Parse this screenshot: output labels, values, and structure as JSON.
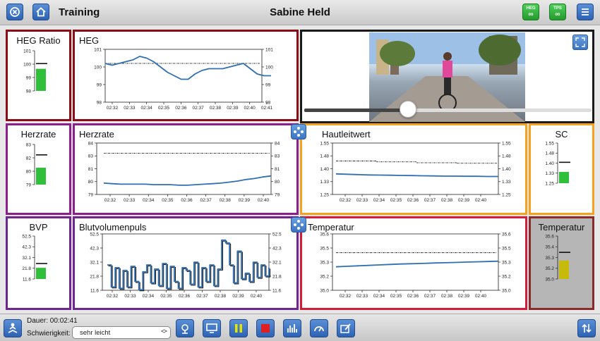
{
  "header": {
    "title": "Training",
    "user": "Sabine Held",
    "heg_btn": "HEG",
    "tps_btn": "TPS"
  },
  "colors": {
    "heg": "#8b0d17",
    "herzrate": "#8b1f8c",
    "hautleitwert": "#f5a21e",
    "bvp": "#6e2690",
    "temperatur": "#d21e3c",
    "video": "#1a1a1a",
    "line": "#2f6fb2",
    "bar_green": "#2fbf3a",
    "bar_yellow": "#c6bb0a"
  },
  "panels": {
    "heg_ratio": {
      "title": "HEG Ratio",
      "ticks": [
        "101",
        "100",
        "99",
        "98"
      ],
      "fill": 0.55,
      "target": 0.68
    },
    "heg": {
      "title": "HEG"
    },
    "herzrate_small": {
      "title": "Herzrate",
      "ticks": [
        "83",
        "82",
        "80",
        "79"
      ],
      "fill": 0.42,
      "target": 0.74
    },
    "herzrate": {
      "title": "Herzrate"
    },
    "haut": {
      "title": "Hautleitwert"
    },
    "sc": {
      "title": "SC",
      "ticks": [
        "1.55",
        "1.48",
        "1.40",
        "1.33",
        "1.25"
      ],
      "fill": 0.28,
      "target": 0.52
    },
    "bvp_small": {
      "title": "BVP",
      "ticks": [
        "52.5",
        "42.3",
        "32.1",
        "21.8",
        "11.6"
      ],
      "fill": 0.26,
      "target": 0.36
    },
    "bvp": {
      "title": "Blutvolumenpuls"
    },
    "temp": {
      "title": "Temperatur"
    },
    "temp_small": {
      "title": "Temperatur",
      "ticks": [
        "35.6",
        "35.4",
        "35.3",
        "35.2",
        "35.0"
      ],
      "fill": 0.43,
      "target": 0.62
    }
  },
  "video": {
    "progress": 0.36
  },
  "footer": {
    "dauer_label": "Dauer: 00:02:41",
    "schwierigkeit_label": "Schwierigkeit:",
    "difficulty": "sehr leicht"
  },
  "chart_data": [
    {
      "type": "line",
      "name": "HEG",
      "x_ticks": [
        "02:32",
        "02:33",
        "02:34",
        "02:35",
        "02:36",
        "02:37",
        "02:38",
        "02:39",
        "02:40",
        "02:41"
      ],
      "y_ticks": [
        "101",
        "100",
        "99",
        "98"
      ],
      "ylim": [
        98,
        101
      ],
      "threshold": 100.2,
      "values": [
        100.2,
        100.1,
        100.2,
        100.3,
        100.4,
        100.6,
        100.5,
        100.3,
        100.0,
        99.7,
        99.5,
        99.3,
        99.3,
        99.6,
        99.8,
        99.9,
        99.9,
        99.9,
        100.0,
        100.1,
        100.2,
        99.9,
        99.6,
        99.5,
        99.5
      ]
    },
    {
      "type": "line",
      "name": "Herzrate",
      "x_ticks": [
        "02:32",
        "02:33",
        "02:34",
        "02:35",
        "02:36",
        "02:37",
        "02:38",
        "02:39",
        "02:40"
      ],
      "y_ticks": [
        "84",
        "83",
        "81",
        "80",
        "79"
      ],
      "ylim": [
        79,
        84
      ],
      "threshold": 83.0,
      "values": [
        80.1,
        80.05,
        80.0,
        80.0,
        80.0,
        80.0,
        79.95,
        79.95,
        79.95,
        79.9,
        79.9,
        79.95,
        80.0,
        80.05,
        80.1,
        80.2,
        80.3,
        80.45,
        80.55,
        80.7,
        80.8
      ]
    },
    {
      "type": "line",
      "name": "Hautleitwert",
      "x_ticks": [
        "02:32",
        "02:33",
        "02:34",
        "02:35",
        "02:36",
        "02:37",
        "02:38",
        "02:39",
        "02:40"
      ],
      "y_ticks": [
        "1.55",
        "1.48",
        "1.40",
        "1.33",
        "1.25"
      ],
      "ylim": [
        1.25,
        1.55
      ],
      "threshold_steps": [
        1.445,
        1.44,
        1.435,
        1.432
      ],
      "values": [
        1.37,
        1.368,
        1.366,
        1.364,
        1.363,
        1.362,
        1.361,
        1.36,
        1.359,
        1.358,
        1.357,
        1.357,
        1.356,
        1.356,
        1.355,
        1.355
      ]
    },
    {
      "type": "line",
      "name": "Blutvolumenpuls",
      "x_ticks": [
        "02:32",
        "02:33",
        "02:34",
        "02:35",
        "02:36",
        "02:37",
        "02:38",
        "02:39",
        "02:40"
      ],
      "y_ticks": [
        "52.5",
        "42.3",
        "32.1",
        "21.8",
        "11.6"
      ],
      "ylim": [
        11.6,
        52.5
      ],
      "values": [
        30,
        14,
        28,
        13,
        26,
        14,
        29,
        18,
        12,
        25,
        30,
        17,
        27,
        15,
        31,
        13,
        29,
        18,
        13,
        28,
        26,
        16,
        32,
        14,
        28,
        18,
        30,
        15,
        27,
        48,
        46,
        30,
        17,
        40,
        20,
        24,
        18,
        32,
        21,
        30,
        22,
        28
      ]
    },
    {
      "type": "line",
      "name": "Temperatur",
      "x_ticks": [
        "02:32",
        "02:33",
        "02:34",
        "02:35",
        "02:36",
        "02:37",
        "02:38",
        "02:39",
        "02:40"
      ],
      "y_ticks": [
        "35.6",
        "35.5",
        "35.3",
        "35.2",
        "35.0"
      ],
      "ylim": [
        35.0,
        35.6
      ],
      "threshold": 35.4,
      "values": [
        35.25,
        35.255,
        35.26,
        35.265,
        35.27,
        35.275,
        35.28,
        35.283,
        35.286,
        35.29,
        35.293,
        35.296,
        35.3,
        35.303,
        35.306,
        35.31
      ]
    }
  ]
}
